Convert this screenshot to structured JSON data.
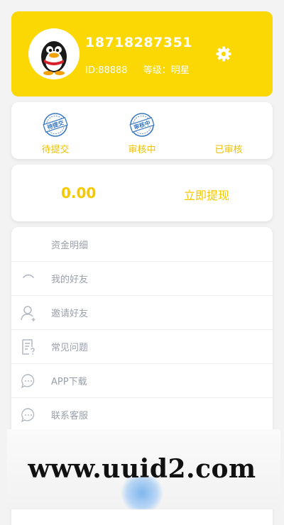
{
  "profile": {
    "phone": "18718287351",
    "id_text": "ID:88888",
    "level_text": "等级：明星"
  },
  "status": {
    "items": [
      {
        "label": "待提交",
        "stamp_text": "待提交"
      },
      {
        "label": "审核中",
        "stamp_text": "审核中"
      },
      {
        "label": "已审核"
      }
    ]
  },
  "balance": {
    "amount": "0.00",
    "withdraw_label": "立即提现"
  },
  "menu": {
    "items": [
      {
        "label": "资金明细"
      },
      {
        "label": "我的好友"
      },
      {
        "label": "邀请好友"
      },
      {
        "label": "常见问题"
      },
      {
        "label": "APP下载"
      },
      {
        "label": "联系客服"
      }
    ]
  },
  "watermark": {
    "text": "www.uuid2.com"
  },
  "colors": {
    "accent": "#fbd704",
    "accent_text": "#f5c800",
    "stamp_blue": "#3a78c2",
    "menu_text": "#9aa0aa"
  }
}
